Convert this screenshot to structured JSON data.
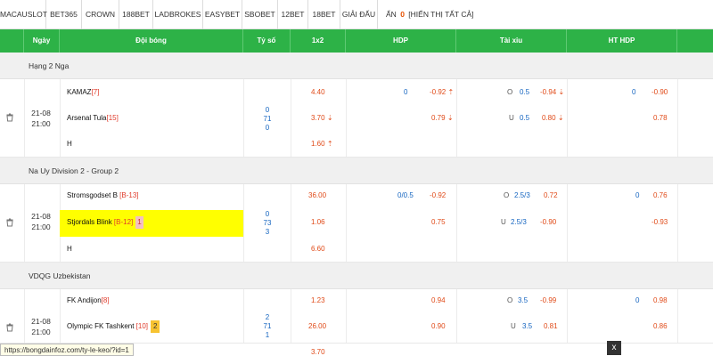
{
  "tabs": [
    "MACAUSLOT",
    "BET365",
    "CROWN",
    "188BET",
    "LADBROKES",
    "EASYBET",
    "SBOBET",
    "12BET",
    "18BET",
    "GIẢI ĐẤU"
  ],
  "hidden_tab": {
    "label": "ẨN",
    "count": "0",
    "show_all": "[HIỂN THỊ TẤT CẢ]"
  },
  "header": {
    "date": "Ngày",
    "teams": "Đội bóng",
    "score": "Tỷ số",
    "x12": "1x2",
    "hdp": "HDP",
    "ou": "Tài xỉu",
    "hthdp": "HT HDP"
  },
  "leagues": [
    {
      "name": "Hạng 2 Nga",
      "date": "21-08",
      "time": "21:00",
      "home": {
        "name": "KAMAZ",
        "rank": "[7]"
      },
      "away": {
        "name": "Arsenal Tula",
        "rank": "[15]"
      },
      "draw": "H",
      "score": [
        "0",
        "71",
        "0"
      ],
      "x12": [
        "4.40",
        "3.70",
        "1.60"
      ],
      "hdp": {
        "line": "0",
        "home": "-0.92",
        "away": "0.79"
      },
      "ou": {
        "o": "O",
        "line": "0.5",
        "u": "U",
        "line2": "0.5",
        "home": "-0.94",
        "away": "0.80"
      },
      "ht": {
        "line": "0",
        "home": "-0.90",
        "away": "0.78"
      }
    },
    {
      "name": "Na Uy Division 2 - Group 2",
      "date": "21-08",
      "time": "21:00",
      "home": {
        "name": "Stromsgodset B",
        "rank": "[B-13]"
      },
      "away": {
        "name": "Stjordals Blink",
        "rank": "[B-12]",
        "card": "1"
      },
      "draw": "H",
      "score": [
        "0",
        "73",
        "3"
      ],
      "x12": [
        "36.00",
        "1.06",
        "6.60"
      ],
      "hdp": {
        "line": "0/0.5",
        "home": "-0.92",
        "away": "0.75"
      },
      "ou": {
        "o": "O",
        "line": "2.5/3",
        "u": "U",
        "line2": "2.5/3",
        "home": "0.72",
        "away": "-0.90"
      },
      "ht": {
        "line": "0",
        "home": "0.76",
        "away": "-0.93"
      }
    },
    {
      "name": "VDQG Uzbekistan",
      "date": "21-08",
      "time": "21:00",
      "home": {
        "name": "FK Andijon",
        "rank": "[8]"
      },
      "away": {
        "name": "Olympic FK Tashkent",
        "rank": "[10]",
        "card": "2"
      },
      "draw": "",
      "score": [
        "2",
        "71",
        "1"
      ],
      "x12": [
        "1.23",
        "26.00",
        "3.70"
      ],
      "hdp": {
        "line": "",
        "home": "0.94",
        "away": "0.90"
      },
      "ou": {
        "o": "O",
        "line": "3.5",
        "u": "U",
        "line2": "3.5",
        "home": "-0.99",
        "away": "0.81"
      },
      "ht": {
        "line": "0",
        "home": "0.98",
        "away": "0.86"
      }
    }
  ],
  "statusbar": "https://bongdainfoz.com/ty-le-keo/?id=1",
  "close": "x"
}
